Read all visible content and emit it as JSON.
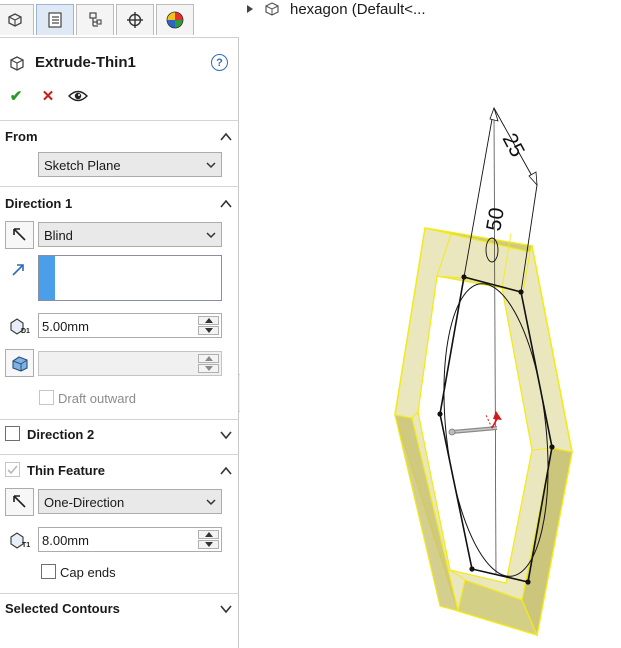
{
  "tabs": [
    {
      "name": "feature-manager-tab"
    },
    {
      "name": "property-manager-tab",
      "active": true
    },
    {
      "name": "configuration-manager-tab"
    },
    {
      "name": "dimxpert-manager-tab"
    },
    {
      "name": "display-manager-tab"
    }
  ],
  "feature": {
    "title": "Extrude-Thin1",
    "help_label": "?"
  },
  "actions": {
    "ok_label": "✔",
    "cancel_label": "✕"
  },
  "from": {
    "header": "From",
    "value": "Sketch Plane"
  },
  "direction1": {
    "header": "Direction 1",
    "end_condition": "Blind",
    "depth": "5.00mm",
    "draft_value": "",
    "draft_outward_label": "Draft outward",
    "draft_outward_checked": false
  },
  "direction2": {
    "header": "Direction 2",
    "checked": false
  },
  "thin_feature": {
    "header": "Thin Feature",
    "checked": true,
    "type": "One-Direction",
    "thickness": "8.00mm",
    "cap_ends_label": "Cap ends",
    "cap_ends_checked": false
  },
  "selected_contours": {
    "header": "Selected Contours"
  },
  "graphics": {
    "tree_label": "hexagon  (Default<...",
    "dimension_25": "25",
    "dimension_50": "50"
  },
  "colors": {
    "accent_blue": "#4b9fea",
    "model_fill": "#d9d48a",
    "model_edge": "#f2ea1c",
    "ok_green": "#2a9b2a",
    "cancel_red": "#cc1a1a"
  }
}
